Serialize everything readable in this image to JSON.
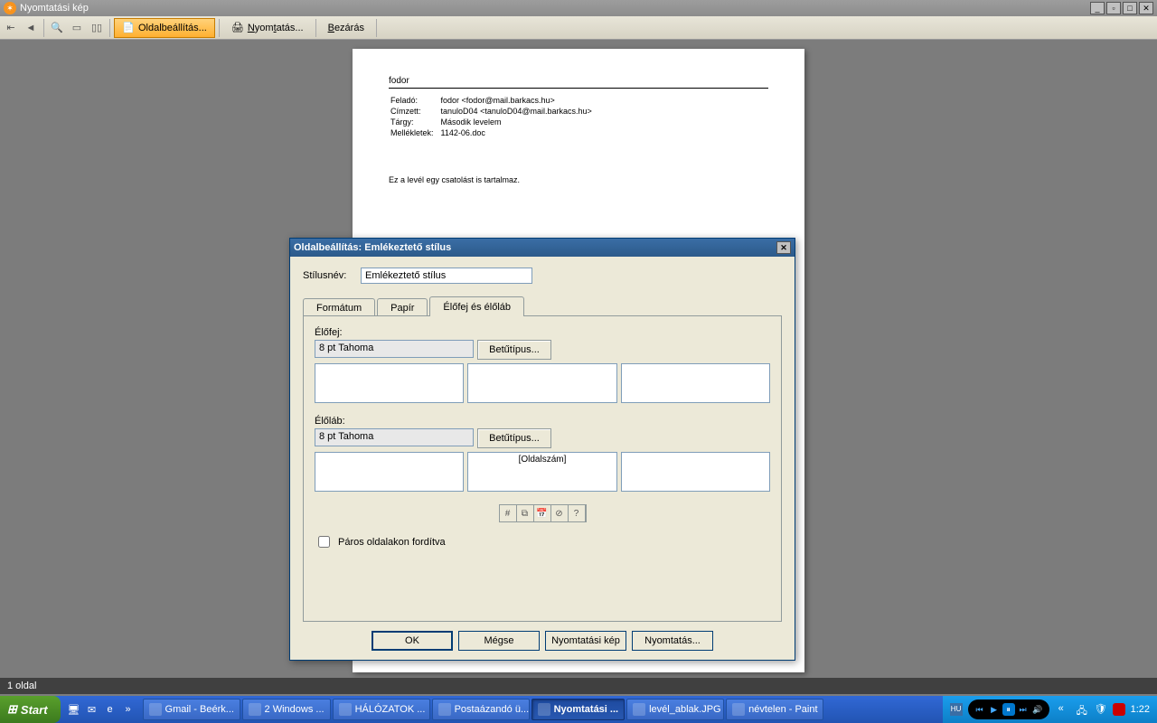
{
  "app": {
    "title": "Nyomtatási kép",
    "toolbar": {
      "page_setup": "Oldalbeállítás...",
      "print": "Nyomtatás...",
      "close": "Bezárás"
    },
    "status": "1 oldal"
  },
  "preview": {
    "heading": "fodor",
    "fields": {
      "from_label": "Feladó:",
      "from_value": "fodor <fodor@mail.barkacs.hu>",
      "to_label": "Címzett:",
      "to_value": "tanuloD04 <tanuloD04@mail.barkacs.hu>",
      "subject_label": "Tárgy:",
      "subject_value": "Második levelem",
      "attach_label": "Mellékletek:",
      "attach_value": "1142-06.doc"
    },
    "notice": "Ez a levél egy csatolást is tartalmaz."
  },
  "dialog": {
    "title": "Oldalbeállítás: Emlékeztető stílus",
    "style_label": "Stílusnév:",
    "style_value": "Emlékeztető stílus",
    "tabs": {
      "format": "Formátum",
      "paper": "Papír",
      "headerfooter": "Élőfej és élőláb"
    },
    "header_label": "Élőfej:",
    "footer_label": "Élőláb:",
    "font_header": "8 pt Tahoma",
    "font_footer": "8 pt Tahoma",
    "font_button": "Betűtípus...",
    "footer_center": "[Oldalszám]",
    "reverse_check": "Páros oldalakon fordítva",
    "buttons": {
      "ok": "OK",
      "cancel": "Mégse",
      "preview": "Nyomtatási kép",
      "print": "Nyomtatás..."
    }
  },
  "taskbar": {
    "start": "Start",
    "items": [
      "Gmail - Beérk...",
      "2 Windows ...",
      "HÁLÓZATOK ...",
      "Postaázandó ü...",
      "Nyomtatási ...",
      "levél_ablak.JPG",
      "névtelen - Paint"
    ],
    "clock": "1:22"
  }
}
